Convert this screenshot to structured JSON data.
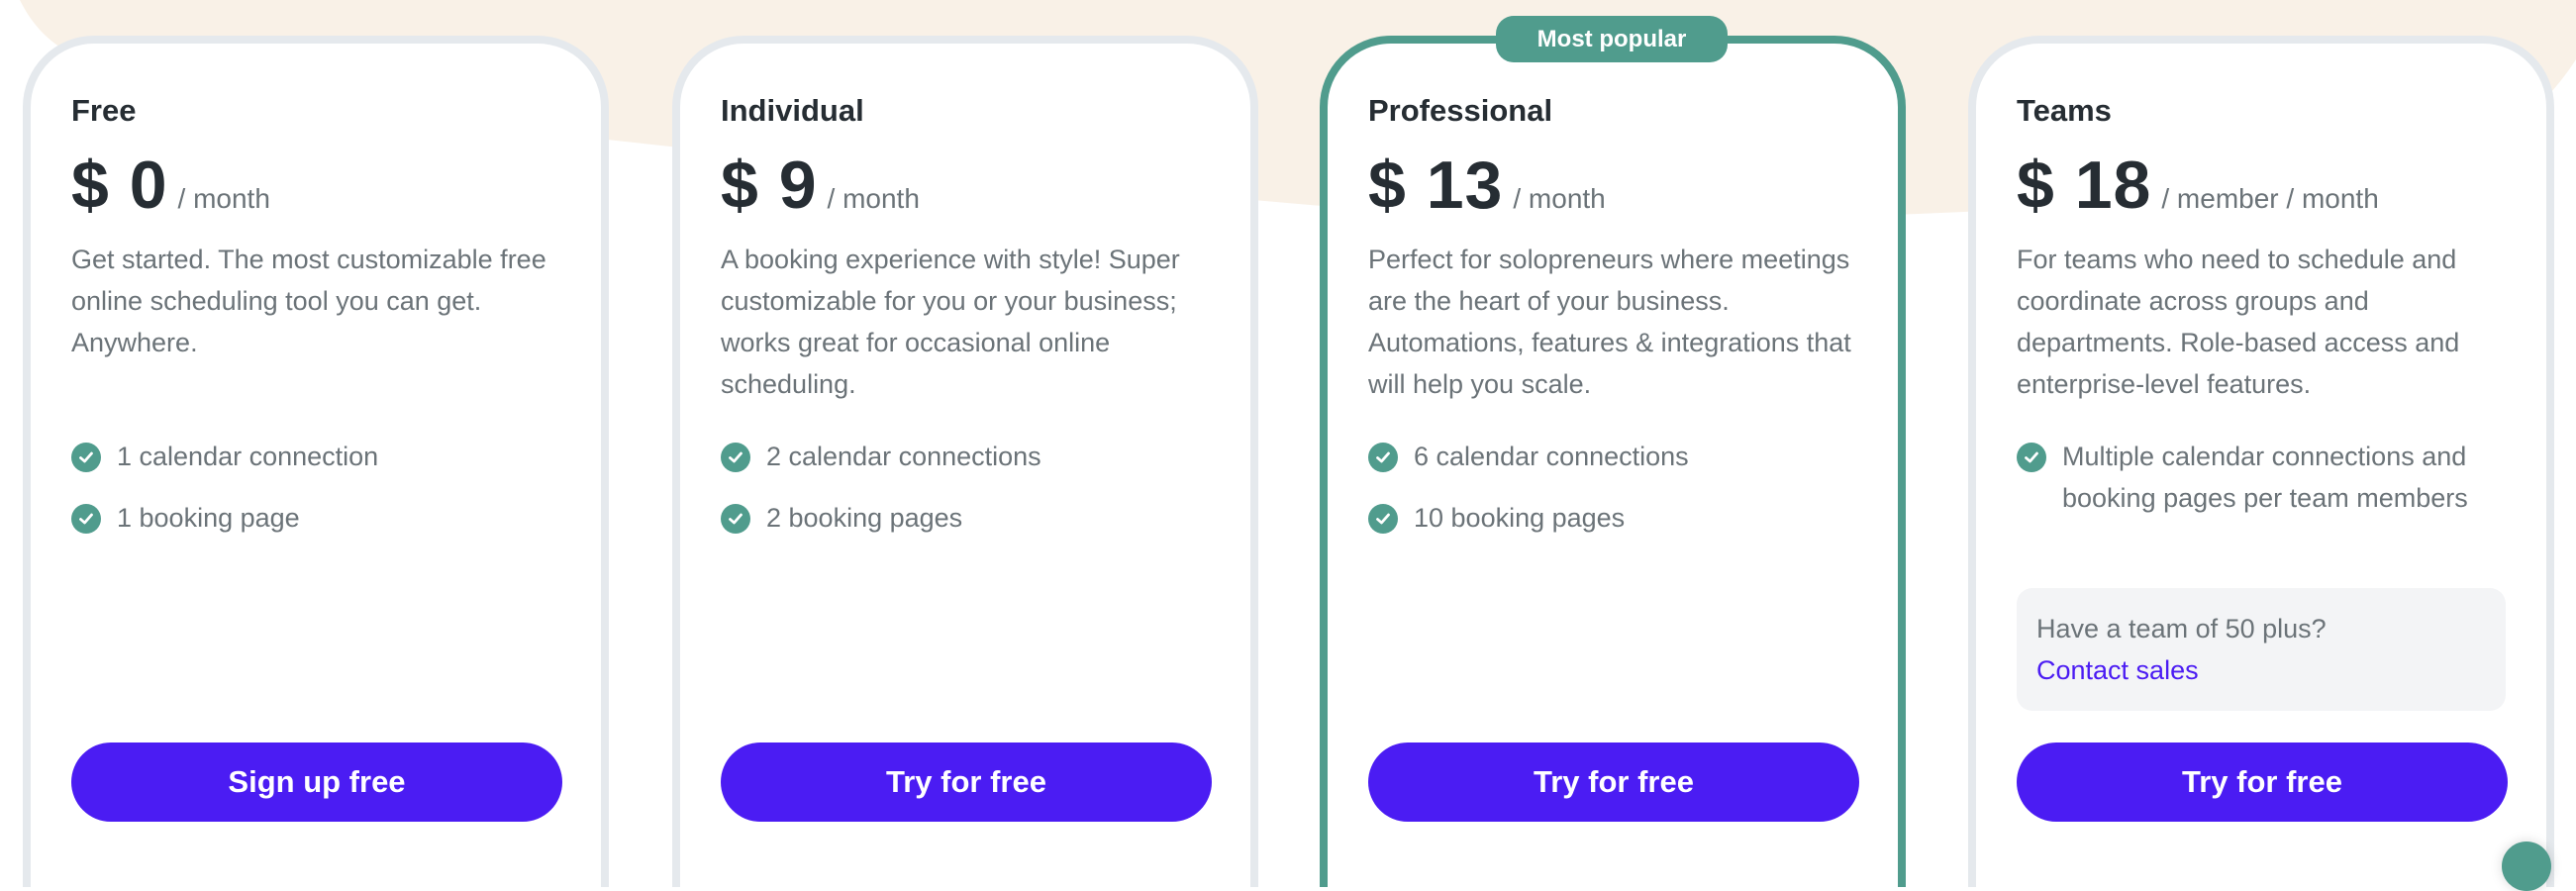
{
  "colors": {
    "brand_button": "#4b1cf3",
    "accent_teal": "#509c8d",
    "card_border": "#e5e9ed",
    "background_blob": "#f9f1e7",
    "link": "#4b1cf3"
  },
  "badge": {
    "label": "Most popular"
  },
  "plans": [
    {
      "name": "Free",
      "price": "$ 0",
      "unit": "/ month",
      "description": "Get started. The most customizable free online scheduling tool you can get. Anywhere.",
      "features": [
        "1 calendar connection",
        "1 booking page"
      ],
      "cta": "Sign up free"
    },
    {
      "name": "Individual",
      "price": "$ 9",
      "unit": "/ month",
      "description": "A booking experience with style! Super customizable for you or your business; works great for occasional online scheduling.",
      "features": [
        "2 calendar connections",
        "2 booking pages"
      ],
      "cta": "Try for free"
    },
    {
      "name": "Professional",
      "price": "$ 13",
      "unit": "/ month",
      "description": "Perfect for solopreneurs where meetings are the heart of your business. Automations, features & integrations that will help you scale.",
      "features": [
        "6 calendar connections",
        "10 booking pages"
      ],
      "cta": "Try for free",
      "popular": true
    },
    {
      "name": "Teams",
      "price": "$ 18",
      "unit": "/ member / month",
      "description": "For teams who need to schedule and coordinate across groups and departments. Role-based access and enterprise-level features.",
      "features": [
        "Multiple calendar connections and booking pages per team members"
      ],
      "contact": {
        "question": "Have a team of 50 plus?",
        "link": "Contact sales"
      },
      "cta": "Try for free"
    }
  ],
  "icons": {
    "feature": "check-circle-icon",
    "chat": "chat-widget-icon"
  }
}
